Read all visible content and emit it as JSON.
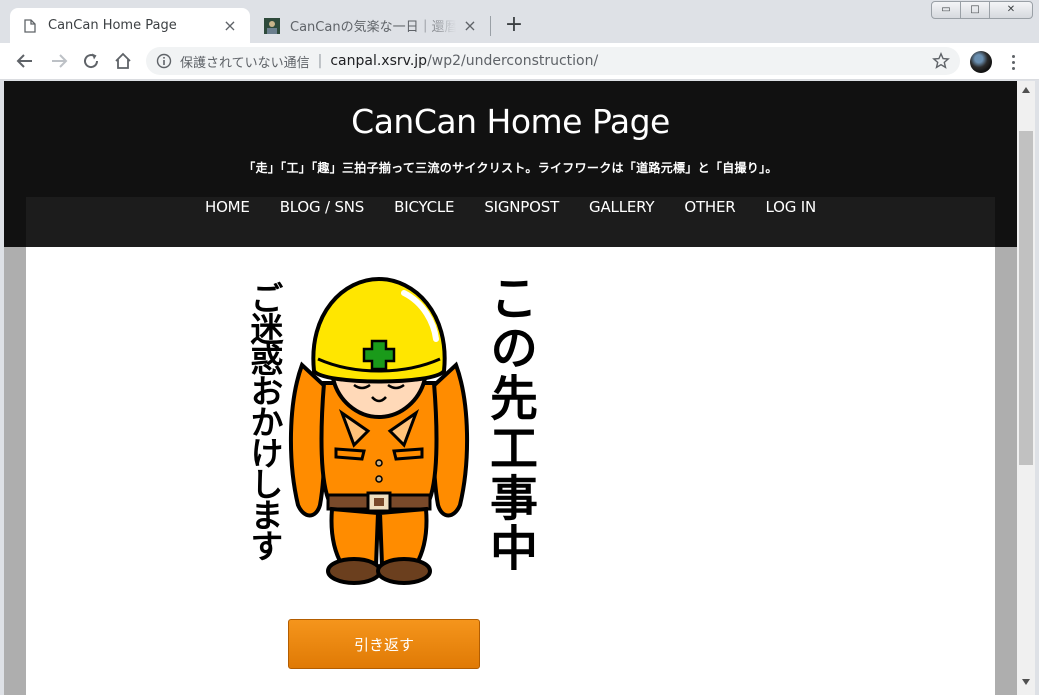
{
  "tabs": [
    {
      "title": "CanCan Home Page",
      "icon": "document-icon",
      "active": true
    },
    {
      "title": "CanCanの気楽な一日｜還暦を迎",
      "icon": "site-favicon",
      "active": false
    }
  ],
  "window": {
    "minimize": "▭",
    "maximize": "□",
    "close": "✕"
  },
  "address_bar": {
    "security_text": "保護されていない通信",
    "host": "canpal.xsrv.jp",
    "path": "/wp2/underconstruction/"
  },
  "site": {
    "title": "CanCan Home Page",
    "tagline": "「走」「工」「趣」三拍子揃って三流のサイクリスト。ライフワークは「道路元標」と「自撮り」。"
  },
  "nav": [
    "HOME",
    "BLOG / SNS",
    "BICYCLE",
    "SIGNPOST",
    "GALLERY",
    "OTHER",
    "LOG IN"
  ],
  "sign": {
    "left_text": "ご迷惑おかけします",
    "right_text": "この先工事中"
  },
  "back_button": "引き返す",
  "colors": {
    "header_bg": "#111111",
    "navbar_bg": "#1c1c1c",
    "helmet": "#ffe600",
    "uniform": "#ff8c00",
    "cross": "#1a9a1a",
    "button": "#ee8a0f"
  }
}
